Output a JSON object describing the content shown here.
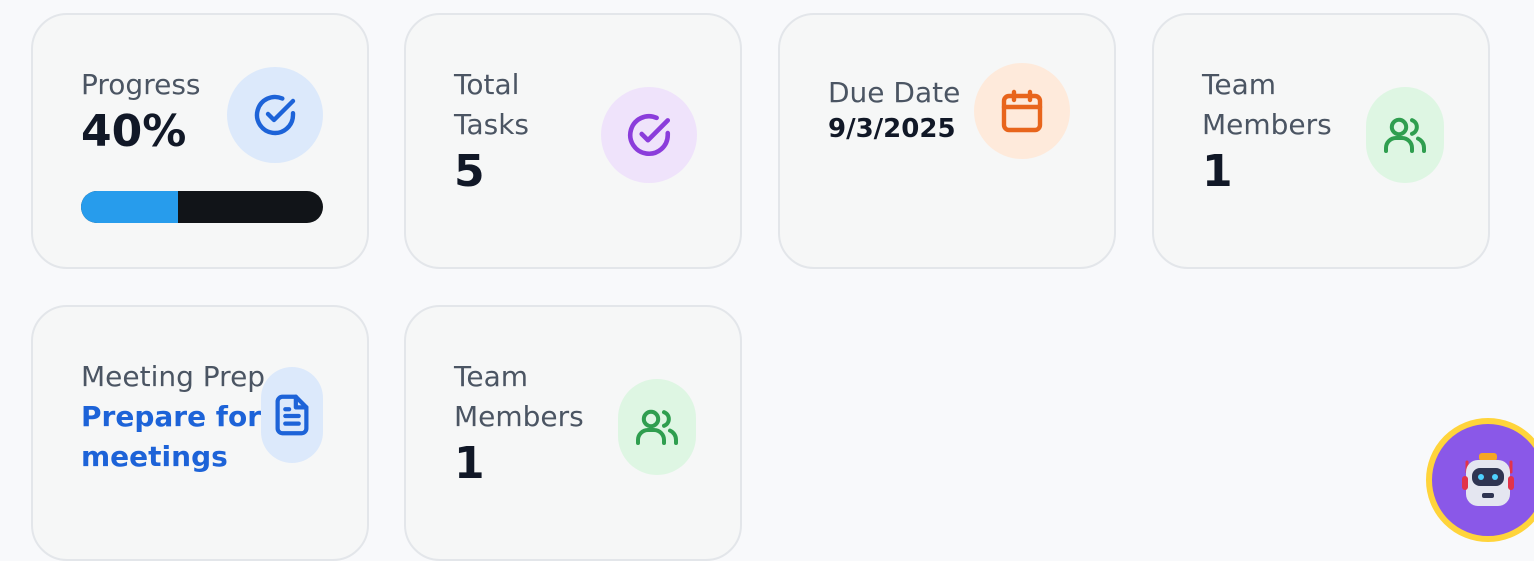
{
  "cards": {
    "progress": {
      "label": "Progress",
      "value": "40%",
      "percent": 40,
      "icon": "check-circle-icon"
    },
    "total_tasks": {
      "label_line1": "Total",
      "label_line2": "Tasks",
      "value": "5",
      "icon": "check-circle-icon"
    },
    "due_date": {
      "label": "Due Date",
      "value": "9/3/2025",
      "icon": "calendar-icon"
    },
    "team_members_1": {
      "label_line1": "Team",
      "label_line2": "Members",
      "value": "1",
      "icon": "users-icon"
    },
    "meeting_prep": {
      "label": "Meeting Prep",
      "desc_line1": "Prepare for",
      "desc_line2": "meetings",
      "icon": "document-icon"
    },
    "team_members_2": {
      "label_line1": "Team",
      "label_line2": "Members",
      "value": "1",
      "icon": "users-icon"
    }
  },
  "assistant": {
    "icon": "robot-icon"
  },
  "colors": {
    "progress_fill": "#279cec",
    "blue_icon": "#1d63d8",
    "purple_icon": "#8b3ddb",
    "orange_icon": "#e8651c",
    "green_icon": "#2f9e4f",
    "assistant_bg": "#8a58e8",
    "assistant_ring": "#ffd43b"
  }
}
